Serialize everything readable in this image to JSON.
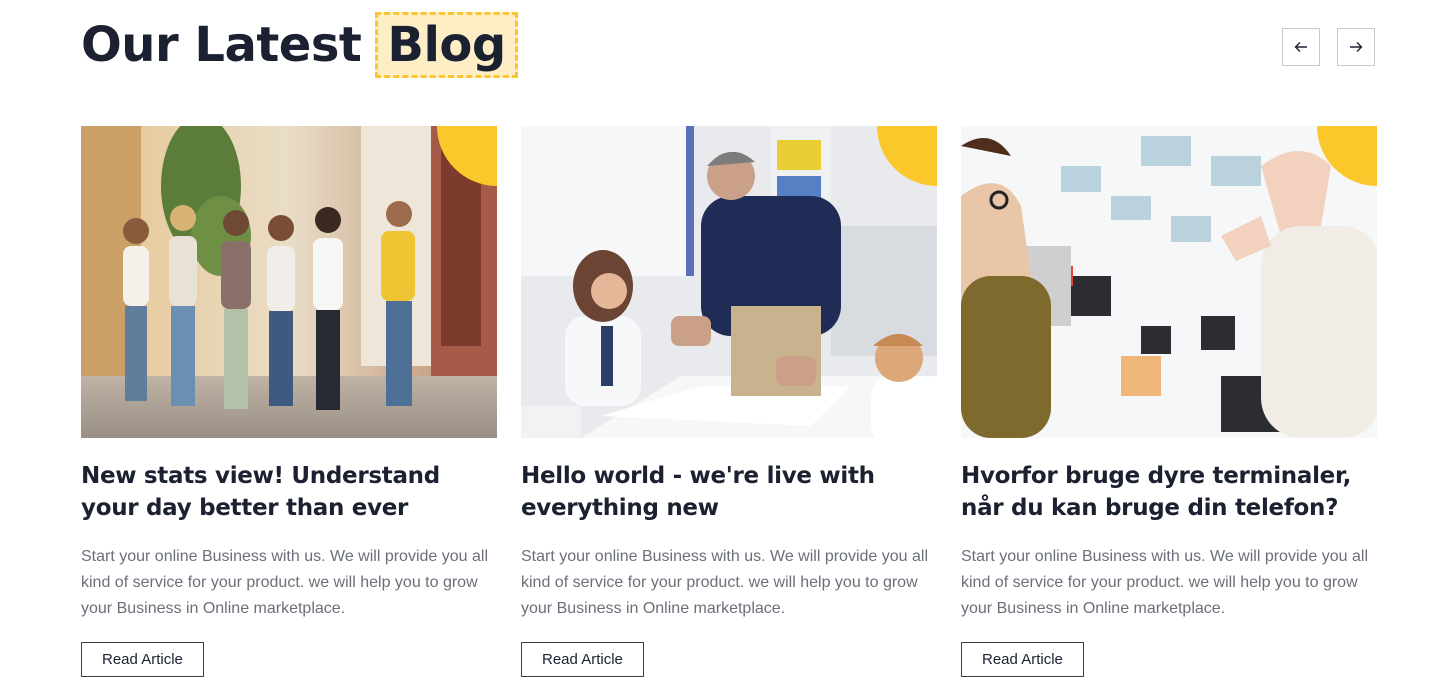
{
  "header": {
    "title_plain": "Our Latest",
    "title_highlight": "Blog"
  },
  "nav": {
    "prev_icon": "arrow-left-icon",
    "next_icon": "arrow-right-icon"
  },
  "colors": {
    "accent_yellow": "#fbc82c",
    "highlight_bg": "#fdeec6",
    "text_dark": "#1b2130",
    "text_muted": "#6b6f7a"
  },
  "posts": [
    {
      "image": "students-walking-photo",
      "title": "New stats view! Understand your day better than ever",
      "excerpt": "Start your online Business with us. We will provide you all kind of service for your product. we will help you to grow your Business in Online marketplace.",
      "cta": "Read Article"
    },
    {
      "image": "teacher-classroom-photo",
      "title": "Hello world - we're live with everything new",
      "excerpt": "Start your online Business with us. We will provide you all kind of service for your product. we will help you to grow your Business in Online marketplace.",
      "cta": "Read Article"
    },
    {
      "image": "designers-moodboard-photo",
      "title": "Hvorfor bruge dyre terminaler, når du kan bruge din telefon?",
      "excerpt": "Start your online Business with us. We will provide you all kind of service for your product. we will help you to grow your Business in Online marketplace.",
      "cta": "Read Article"
    }
  ]
}
